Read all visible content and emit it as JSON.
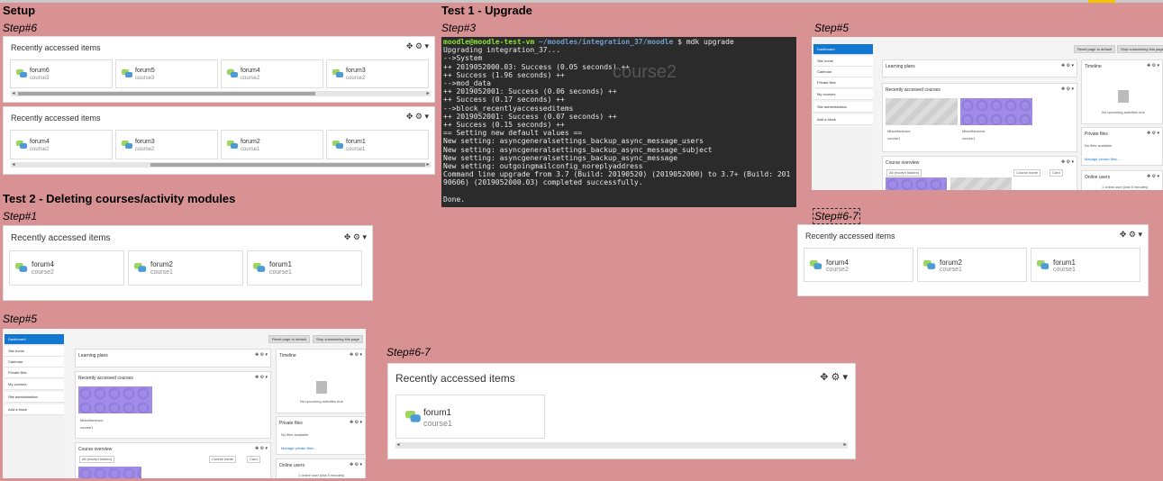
{
  "headings": {
    "setup": "Setup",
    "test1": "Test 1 - Upgrade",
    "test2": "Test 2 - Deleting courses/activity modules"
  },
  "steps": {
    "setup_6": "Step#6",
    "t1_3": "Step#3",
    "t1_5": "Step#5",
    "t1_67": "Step#6-7",
    "t2_1": "Step#1",
    "t2_5": "Step#5",
    "t2_67": "Step#6-7"
  },
  "block": {
    "title": "Recently accessed items",
    "tools": "✥ ⚙ ▾"
  },
  "setup_block1": [
    {
      "name": "forum6",
      "course": "course3"
    },
    {
      "name": "forum5",
      "course": "course3"
    },
    {
      "name": "forum4",
      "course": "course2"
    },
    {
      "name": "forum3",
      "course": "course2"
    }
  ],
  "setup_block2": [
    {
      "name": "forum4",
      "course": "course2"
    },
    {
      "name": "forum3",
      "course": "course2"
    },
    {
      "name": "forum2",
      "course": "course1"
    },
    {
      "name": "forum1",
      "course": "course1"
    }
  ],
  "t2_step1": [
    {
      "name": "forum4",
      "course": "course2"
    },
    {
      "name": "forum2",
      "course": "course1"
    },
    {
      "name": "forum1",
      "course": "course1"
    }
  ],
  "t1_step67": [
    {
      "name": "forum4",
      "course": "course2"
    },
    {
      "name": "forum2",
      "course": "course1"
    },
    {
      "name": "forum1",
      "course": "course1"
    }
  ],
  "t2_step67": [
    {
      "name": "forum1",
      "course": "course1"
    }
  ],
  "terminal": {
    "prompt_user": "moodle@moodle-test-vm",
    "prompt_path": "~/moodles/integration_37/moodle",
    "command": "$ mdk upgrade",
    "lines": [
      "Upgrading integration_37...",
      "-->System",
      "++ 2019052000.03: Success (0.05 seconds) ++",
      "++ Success (1.96 seconds) ++",
      "-->mod_data",
      "++ 2019052001: Success (0.06 seconds) ++",
      "++ Success (0.17 seconds) ++",
      "-->block_recentlyaccesseditems",
      "++ 2019052001: Success (0.07 seconds) ++",
      "++ Success (0.15 seconds) ++",
      "== Setting new default values ==",
      "New setting: asyncgeneralsettings_backup_async_message_users",
      "New setting: asyncgeneralsettings_backup_async_message_subject",
      "New setting: asyncgeneralsettings_backup_async_message",
      "New setting: outgoingmailconfig_noreplyaddress",
      "Command line upgrade from 3.7 (Build: 20190520) (2019052000) to 3.7+ (Build: 201",
      "90606) (2019052000.03) completed successfully.",
      "",
      "Done."
    ],
    "watermark": "course2"
  },
  "dashboard": {
    "nav": [
      "Dashboard",
      "Site home",
      "Calendar",
      "Private files",
      "My courses",
      "Site administration",
      "Add a block"
    ],
    "reset_button": "Reset page to default",
    "stop_button": "Stop customising this page",
    "learning_plans": "Learning plans",
    "recent_items": "Recently accessed courses",
    "course_overview": "Course overview",
    "timeline": "Timeline",
    "no_activities": "No upcoming activities due",
    "private_files": "Private files",
    "no_files": "No files available",
    "manage_files": "Manage private files...",
    "online_users": "Online users",
    "online_count": "1 online user (last 5 minutes)",
    "course_category": "Miscellaneous",
    "course_name": "course1",
    "all_filter": "All (except hidden)",
    "sort_course": "Course name",
    "view_card": "Card"
  }
}
